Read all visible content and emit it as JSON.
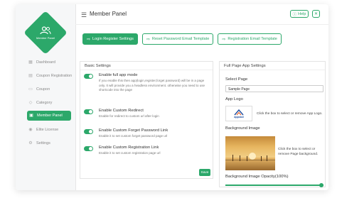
{
  "app": {
    "title": "Member Panel",
    "logo_text": "Member Panel"
  },
  "header": {
    "help_label": "Help",
    "close_label": "✕"
  },
  "sidebar": {
    "items": [
      {
        "label": "Dashboard",
        "icon": "▦"
      },
      {
        "label": "Coupon Registration",
        "icon": "▤"
      },
      {
        "label": "Coupon",
        "icon": "▭"
      },
      {
        "label": "Category",
        "icon": "◇"
      },
      {
        "label": "Member Panel",
        "icon": "▣"
      },
      {
        "label": "Elite License",
        "icon": "◉"
      },
      {
        "label": "Settings",
        "icon": "⚙"
      }
    ]
  },
  "tabs": [
    {
      "label": "Login Register Settings",
      "icon": "⇨"
    },
    {
      "label": "Reset Password Email Template",
      "icon": "⇨"
    },
    {
      "label": "Registration Email Template",
      "icon": "⇨"
    }
  ],
  "basic": {
    "title": "Basic Settings",
    "settings": [
      {
        "label": "Enable full app mode",
        "desc": "If you enable this then app(login,register,forget password) will be in a page only. It will provide you a headless environment. otherwise you need to use shortcode into the page",
        "on": true
      },
      {
        "label": "Enable Custom Redirect",
        "desc": "Enable for redirect to custom url after login",
        "on": true
      },
      {
        "label": "Enable Custom Forget Password Link",
        "desc": "Enable it to set custom forget password page url",
        "on": true
      },
      {
        "label": "Enable Custom Registration Link",
        "desc": "Enable it to set custom registration page url",
        "on": true
      }
    ],
    "save_label": "Save"
  },
  "fullpage": {
    "title": "Full Page App Settings",
    "select_page_label": "Select Page",
    "select_value": "Sample Page",
    "app_logo_label": "App Logo",
    "app_logo_text": "appsbd",
    "app_logo_note": "Click the box to select or remove App Logo.",
    "bg_image_label": "Background Image",
    "bg_image_note": "Click the box to select or remove Page background.",
    "opacity_label": "Background Image Opacity(100%)",
    "opacity_value": 1.0
  },
  "colors": {
    "accent": "#2ca86a"
  }
}
